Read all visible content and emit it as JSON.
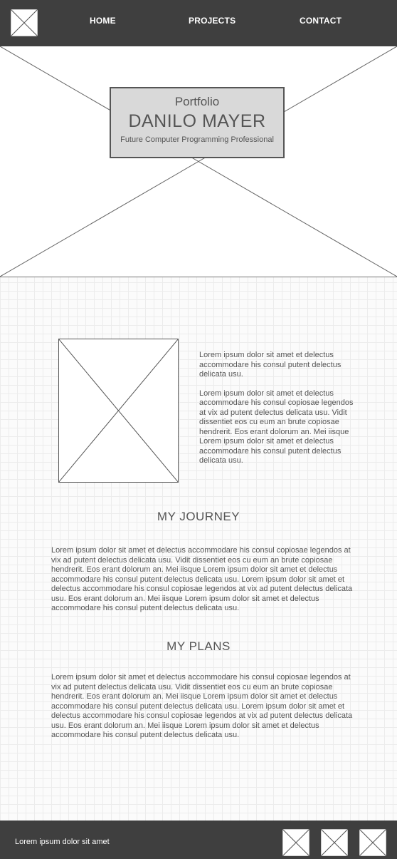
{
  "nav": {
    "links": [
      {
        "label": "HOME"
      },
      {
        "label": "PROJECTS"
      },
      {
        "label": "CONTACT"
      }
    ]
  },
  "hero": {
    "kicker": "Portfolio",
    "name": "DANILO MAYER",
    "tagline": "Future Computer Programming Professional"
  },
  "about": {
    "paragraphs": [
      "Lorem ipsum dolor sit amet et delectus accommodare his consul putent delectus delicata usu.",
      "Lorem ipsum dolor sit amet et delectus accommodare his consul copiosae legendos at vix ad putent delectus delicata usu. Vidit dissentiet eos cu eum an brute copiosae hendrerit. Eos erant dolorum an. Mei iisque Lorem ipsum dolor sit amet et delectus accommodare his consul putent delectus delicata usu."
    ]
  },
  "journey": {
    "title": "MY JOURNEY",
    "body": "Lorem ipsum dolor sit amet et delectus accommodare his consul copiosae legendos at vix ad putent delectus delicata usu. Vidit dissentiet eos cu eum an brute copiosae hendrerit. Eos erant dolorum an. Mei iisque Lorem ipsum dolor sit amet et delectus accommodare his consul putent delectus delicata usu. Lorem ipsum dolor sit amet et delectus accommodare his consul copiosae legendos at vix ad putent delectus delicata usu. Eos erant dolorum an. Mei iisque Lorem ipsum dolor sit amet et delectus accommodare his consul putent delectus delicata usu."
  },
  "plans": {
    "title": "MY PLANS",
    "body": "Lorem ipsum dolor sit amet et delectus accommodare his consul copiosae legendos at vix ad putent delectus delicata usu. Vidit dissentiet eos cu eum an brute copiosae hendrerit. Eos erant dolorum an. Mei iisque Lorem ipsum dolor sit amet et delectus accommodare his consul putent delectus delicata usu. Lorem ipsum dolor sit amet et delectus accommodare his consul copiosae legendos at vix ad putent delectus delicata usu. Eos erant dolorum an. Mei iisque Lorem ipsum dolor sit amet et delectus accommodare his consul putent delectus delicata usu."
  },
  "footer": {
    "text": "Lorem ipsum dolor sit amet",
    "icons": [
      "image-placeholder-icon",
      "image-placeholder-icon",
      "image-placeholder-icon"
    ]
  },
  "colors": {
    "bar": "#3f3f3f",
    "hero_box": "#d9d9d9",
    "grid_line": "#ececec"
  }
}
